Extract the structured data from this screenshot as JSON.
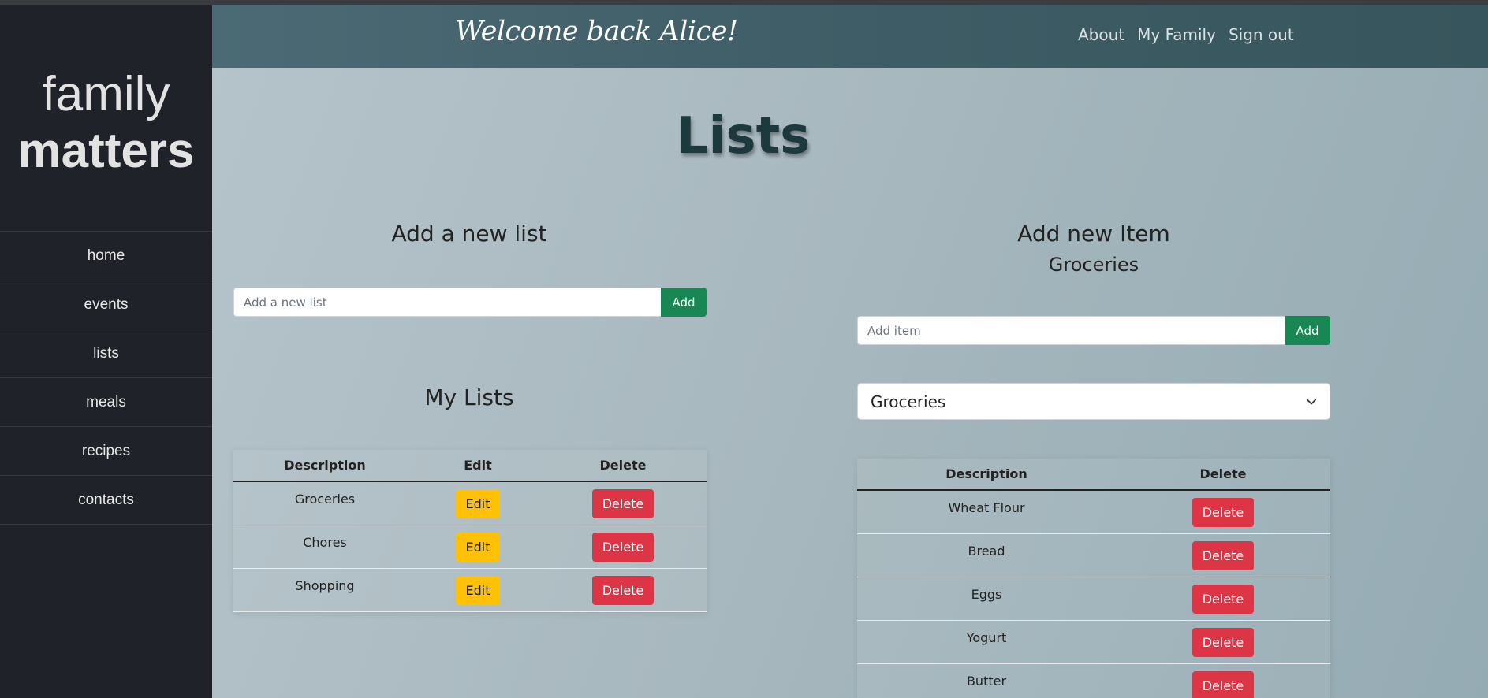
{
  "sidebar": {
    "brand_line1": "family",
    "brand_line2": "matters",
    "items": [
      {
        "label": "home"
      },
      {
        "label": "events"
      },
      {
        "label": "lists"
      },
      {
        "label": "meals"
      },
      {
        "label": "recipes"
      },
      {
        "label": "contacts"
      }
    ]
  },
  "header": {
    "welcome": "Welcome back Alice!",
    "links": [
      {
        "label": "About"
      },
      {
        "label": "My Family"
      },
      {
        "label": "Sign out"
      }
    ]
  },
  "page_title": "Lists",
  "new_list": {
    "heading": "Add a new list",
    "placeholder": "Add a new list",
    "button": "Add"
  },
  "my_lists": {
    "heading": "My Lists",
    "columns": [
      "Description",
      "Edit",
      "Delete"
    ],
    "rows": [
      {
        "description": "Groceries",
        "edit": "Edit",
        "delete": "Delete"
      },
      {
        "description": "Chores",
        "edit": "Edit",
        "delete": "Delete"
      },
      {
        "description": "Shopping",
        "edit": "Edit",
        "delete": "Delete"
      }
    ]
  },
  "new_item": {
    "heading": "Add new Item",
    "subheading": "Groceries",
    "placeholder": "Add item",
    "button": "Add",
    "selected_list": "Groceries"
  },
  "items": {
    "columns": [
      "Description",
      "Delete"
    ],
    "rows": [
      {
        "description": "Wheat Flour",
        "delete": "Delete"
      },
      {
        "description": "Bread",
        "delete": "Delete"
      },
      {
        "description": "Eggs",
        "delete": "Delete"
      },
      {
        "description": "Yogurt",
        "delete": "Delete"
      },
      {
        "description": "Butter",
        "delete": "Delete"
      }
    ]
  },
  "colors": {
    "sidebar_bg": "#1f2228",
    "topbar_bg": "#416069",
    "add_button": "#198754",
    "edit_button": "#ffc107",
    "delete_button": "#dc3545"
  }
}
